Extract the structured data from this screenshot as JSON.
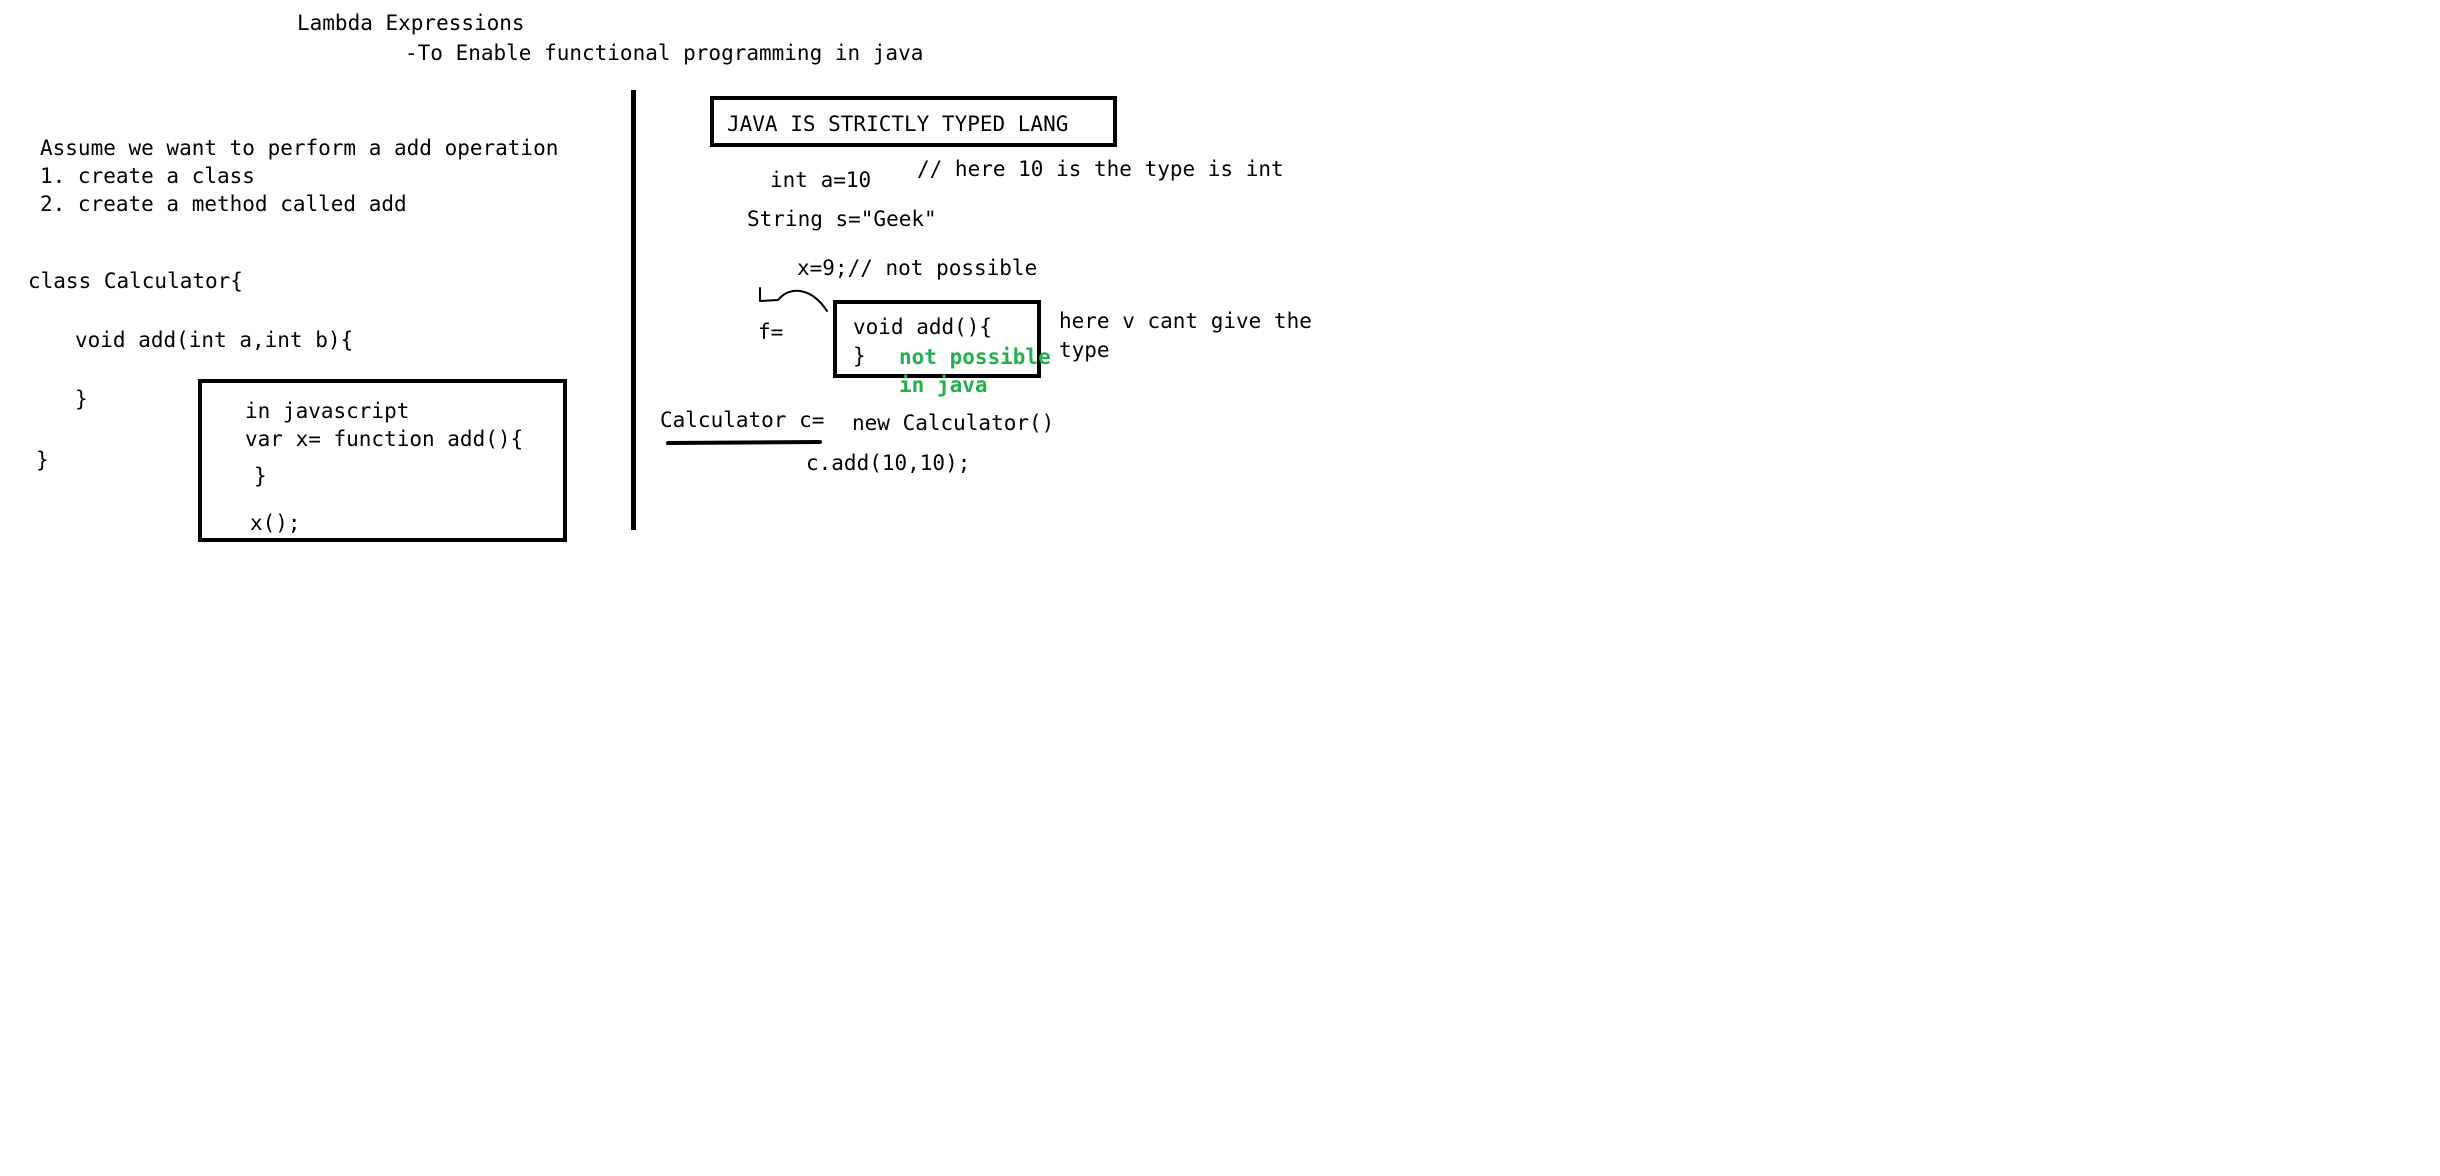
{
  "title": {
    "heading": "Lambda Expressions",
    "subheading": "-To Enable functional programming in java"
  },
  "left_panel": {
    "intro_line": "Assume we want to perform a add operation",
    "steps": [
      "1. create a class",
      "2. create a method called add"
    ],
    "code": {
      "class_decl": "class Calculator{",
      "method_decl": "void add(int a,int b){",
      "method_close": "}",
      "class_close": "}"
    },
    "js_box": {
      "line1": "in javascript",
      "line2": "var x= function add(){",
      "line3": "}",
      "line4": "x();"
    }
  },
  "right_panel": {
    "strict_box_label": "JAVA IS STRICTLY TYPED LANG",
    "int_decl": "int a=10",
    "int_comment": "// here 10 is the type is int",
    "string_decl": "String s=\"Geek\"",
    "reassign": "x=9;// not possible",
    "f_assign": "f=",
    "func_box": {
      "line1": "void add(){",
      "line2": "}"
    },
    "not_possible_note": {
      "line1": "not possible",
      "line2": "in java"
    },
    "type_note": {
      "line1": "here v cant give the",
      "line2": "type"
    },
    "calc_decl": "Calculator c=",
    "new_calc": "new Calculator()",
    "call": "c.add(10,10);"
  },
  "colors": {
    "ink": "#000000",
    "note_green": "#22b14c",
    "background": "#ffffff"
  }
}
